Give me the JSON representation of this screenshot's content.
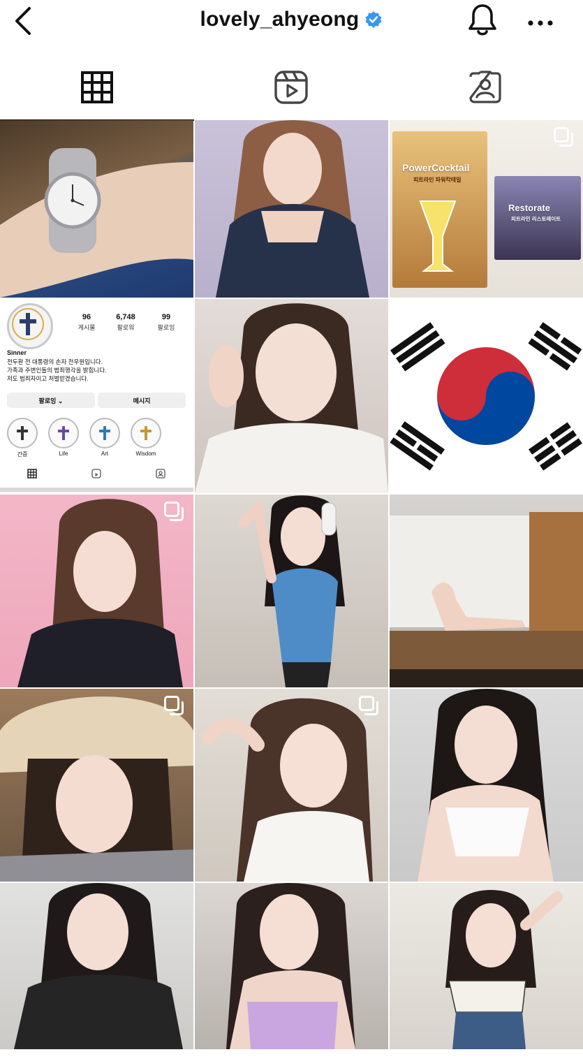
{
  "header": {
    "username": "lovely_ahyeong",
    "verified": true,
    "icons": {
      "back": "chevron-left-icon",
      "verified": "verified-badge-icon",
      "notifications": "bell-icon",
      "more": "more-horizontal-icon"
    }
  },
  "tabs": [
    {
      "name": "posts",
      "icon": "grid-icon",
      "selected": true
    },
    {
      "name": "reels",
      "icon": "reels-icon",
      "selected": false
    },
    {
      "name": "tagged",
      "icon": "tagged-person-icon",
      "selected": false
    }
  ],
  "grid": {
    "posts": [
      {
        "kind": "photo",
        "subject": "wristwatch",
        "multi": false
      },
      {
        "kind": "photo",
        "subject": "portrait",
        "multi": false
      },
      {
        "kind": "photo",
        "subject": "product",
        "multi": true,
        "text_1": "PowerCocktail",
        "text_2": "피트라인 파워칵테일",
        "text_3": "Restorate",
        "text_4": "피트라인 리스토레이트"
      },
      {
        "kind": "profile-screenshot",
        "multi": false
      },
      {
        "kind": "photo",
        "subject": "portrait",
        "multi": false
      },
      {
        "kind": "photo",
        "subject": "korean-flag",
        "multi": false
      },
      {
        "kind": "photo",
        "subject": "portrait",
        "multi": true
      },
      {
        "kind": "photo",
        "subject": "cosplay",
        "multi": false
      },
      {
        "kind": "photo",
        "subject": "room",
        "multi": false
      },
      {
        "kind": "photo",
        "subject": "portrait",
        "multi": true
      },
      {
        "kind": "photo",
        "subject": "portrait",
        "multi": true
      },
      {
        "kind": "photo",
        "subject": "portrait",
        "multi": false
      },
      {
        "kind": "photo",
        "subject": "portrait",
        "multi": false
      },
      {
        "kind": "photo",
        "subject": "portrait",
        "multi": false
      },
      {
        "kind": "photo",
        "subject": "portrait",
        "multi": false
      }
    ]
  },
  "embedded_profile": {
    "stats": [
      {
        "value": "96",
        "label": "게시물"
      },
      {
        "value": "6,748",
        "label": "팔로워"
      },
      {
        "value": "99",
        "label": "팔로잉"
      }
    ],
    "name": "Sinner",
    "bio": [
      "전두환 전 대통령의 손자 전우원입니다.",
      "가족과 주변인들의 범죄행각을 밝힙니다.",
      "저도 범죄자이고 처벌받겠습니다."
    ],
    "follow_button": "팔로잉 ⌄",
    "message_button": "메시지",
    "highlights": [
      "간증",
      "Life",
      "Art",
      "Wisdom"
    ]
  },
  "colors": {
    "text": "#111111",
    "verified": "#3897f0",
    "flag_red": "#cd2e3a",
    "flag_blue": "#0047a0"
  }
}
